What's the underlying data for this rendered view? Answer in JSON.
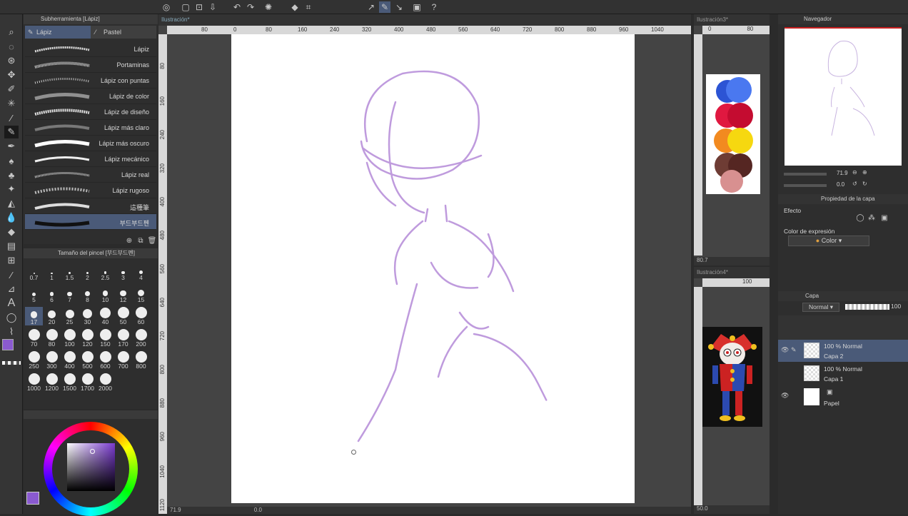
{
  "toolbar": {
    "icons": [
      "navigator-icon",
      "new-file-icon",
      "open-icon",
      "save-icon",
      "export-icon",
      "undo-icon",
      "redo-icon",
      "loading-icon",
      "fill-icon",
      "transform-icon",
      "select-icon",
      "ruler-icon",
      "snap-icon",
      "help-icon"
    ]
  },
  "subtool": {
    "title": "Subherramienta [Lápiz]",
    "tab_active": "Lápiz",
    "tab_other": "Pastel",
    "brushes": [
      "Lápiz",
      "Portaminas",
      "Lápiz con puntas",
      "Lápiz de color",
      "Lápiz de diseño",
      "Lápiz más claro",
      "Lápiz más oscuro",
      "Lápiz mecánico",
      "Lápiz real",
      "Lápiz rugoso",
      "這種筆",
      "부드부드펜"
    ]
  },
  "brush_size": {
    "title": "Tamaño del pincel [부드부드펜]",
    "sizes": [
      "0.7",
      "1",
      "1.5",
      "2",
      "2.5",
      "3",
      "4",
      "5",
      "6",
      "7",
      "8",
      "10",
      "12",
      "15",
      "17",
      "20",
      "25",
      "30",
      "40",
      "50",
      "60",
      "70",
      "80",
      "100",
      "120",
      "150",
      "170",
      "200",
      "250",
      "300",
      "400",
      "500",
      "600",
      "700",
      "800",
      "1000",
      "1200",
      "1500",
      "1700",
      "2000"
    ],
    "selected": "17"
  },
  "canvas": {
    "tab": "Ilustración*",
    "ruler_top": [
      "80",
      "0",
      "80",
      "160",
      "240",
      "320",
      "400",
      "480",
      "560",
      "640",
      "720",
      "800",
      "880",
      "960",
      "1040"
    ],
    "ruler_left": [
      "80",
      "160",
      "240",
      "320",
      "400",
      "480",
      "560",
      "640",
      "720",
      "800",
      "880",
      "960",
      "1040",
      "1120"
    ],
    "zoom": "71.9",
    "angle": "0.0"
  },
  "sub1": {
    "tab": "Ilustración3*",
    "ruler": [
      "0",
      "80"
    ],
    "zoom": "80.7"
  },
  "sub2": {
    "tab": "Ilustración4*",
    "ruler": [
      "100"
    ],
    "zoom": "50.0"
  },
  "navigator": {
    "title": "Navegador",
    "zoom": "71.9",
    "angle": "0.0"
  },
  "layer_prop": {
    "title": "Propiedad de la capa",
    "effect": "Efecto",
    "expr_label": "Color de expresión",
    "expr_value": "Color"
  },
  "layers": {
    "title": "Capa",
    "blend": "Normal",
    "opacity": "100",
    "items": [
      {
        "mode": "100 % Normal",
        "name": "Capa 2"
      },
      {
        "mode": "100 % Normal",
        "name": "Capa 1"
      },
      {
        "mode": "",
        "name": "Papel"
      }
    ]
  },
  "colors": {
    "main": "#8a5ad0",
    "accent": "#5a7cd0",
    "stroke": "#b48ad8"
  }
}
